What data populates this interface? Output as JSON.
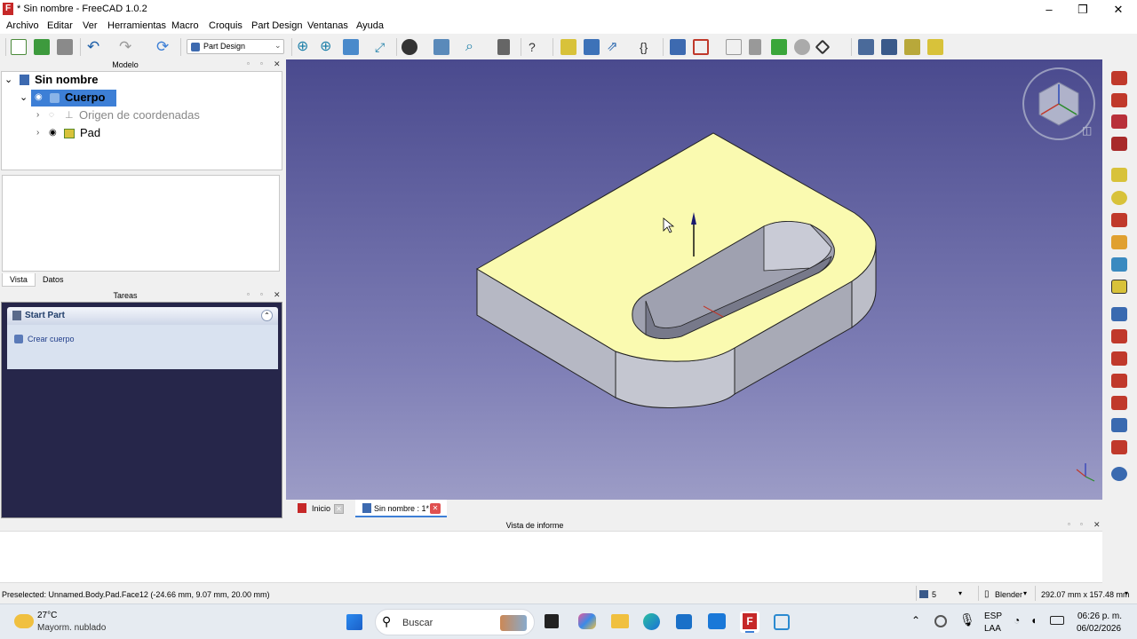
{
  "window": {
    "title": "* Sin nombre - FreeCAD 1.0.2"
  },
  "menu": [
    "Archivo",
    "Editar",
    "Ver",
    "Herramientas",
    "Macro",
    "Croquis",
    "Part Design",
    "Ventanas",
    "Ayuda"
  ],
  "workbench": "Part Design",
  "model_panel": {
    "title": "Modelo",
    "tree": [
      {
        "label": "Sin nombre"
      },
      {
        "label": "Cuerpo"
      },
      {
        "label": "Origen de coordenadas"
      },
      {
        "label": "Pad"
      }
    ],
    "tabs": [
      "Vista",
      "Datos"
    ]
  },
  "tasks_panel": {
    "title": "Tareas",
    "section_title": "Start Part",
    "action": "Crear cuerpo"
  },
  "doc_tabs": [
    {
      "label": "Inicio"
    },
    {
      "label": "Sin nombre : 1*"
    }
  ],
  "report": {
    "title": "Vista de informe"
  },
  "status": {
    "preselected": "Preselected: Unnamed.Body.Pad.Face12 (-24.66 mm, 9.07 mm, 20.00 mm)",
    "count": "5",
    "nav_style": "Blender",
    "dimensions": "292.07 mm x 157.48 mm"
  },
  "taskbar": {
    "temp": "27°C",
    "weather": "Mayorm. nublado",
    "search": "Buscar",
    "lang1": "ESP",
    "lang2": "LAA",
    "time": "06:26 p. m.",
    "date": "06/02/2026"
  },
  "colors": {
    "accent": "#3d7fd6",
    "face": "#fafab0",
    "side": "#b6b8c4",
    "viewport_top": "#4a4a8e"
  }
}
